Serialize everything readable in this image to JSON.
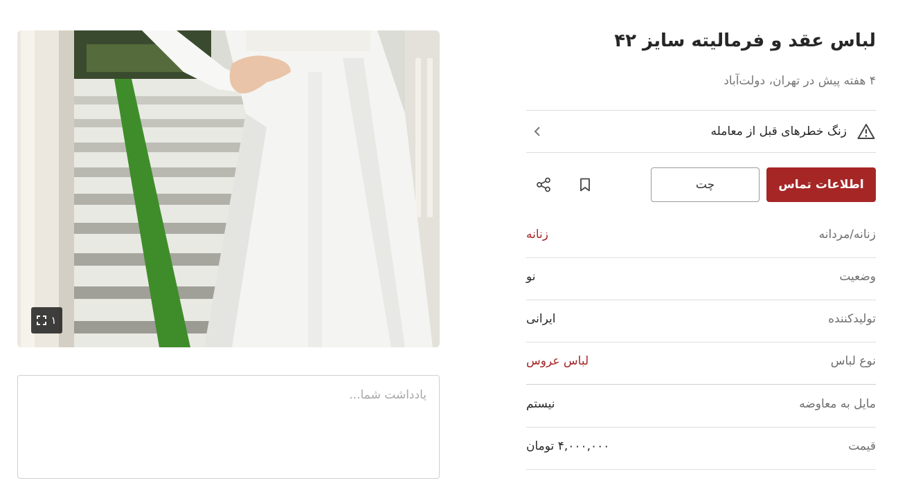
{
  "listing": {
    "title": "لباس عقد و فرمالیته سایز ۴۲",
    "subtitle": "۴ هفته پیش در تهران، دولت‌آباد"
  },
  "warning": {
    "text": "زنگ خطرهای قبل از معامله",
    "icon": "warning-triangle-icon"
  },
  "actions": {
    "contact_label": "اطلاعات تماس",
    "chat_label": "چت",
    "bookmark_icon": "bookmark-icon",
    "share_icon": "share-icon"
  },
  "attributes": [
    {
      "key": "زنانه/مردانه",
      "value": "زنانه",
      "link": true
    },
    {
      "key": "وضعیت",
      "value": "نو",
      "link": false
    },
    {
      "key": "تولیدکننده",
      "value": "ایرانی",
      "link": false
    },
    {
      "key": "نوع لباس",
      "value": "لباس عروس",
      "link": true
    },
    {
      "key": "مایل به معاوضه",
      "value": "نیستم",
      "link": false
    },
    {
      "key": "قیمت",
      "value": "۴,۰۰۰,۰۰۰ تومان",
      "link": false
    }
  ],
  "gallery": {
    "image_count": "۱",
    "expand_icon": "expand-icon"
  },
  "note": {
    "placeholder": "یادداشت شما..."
  },
  "colors": {
    "accent": "#a62626",
    "muted_text": "#6f6f6f"
  }
}
